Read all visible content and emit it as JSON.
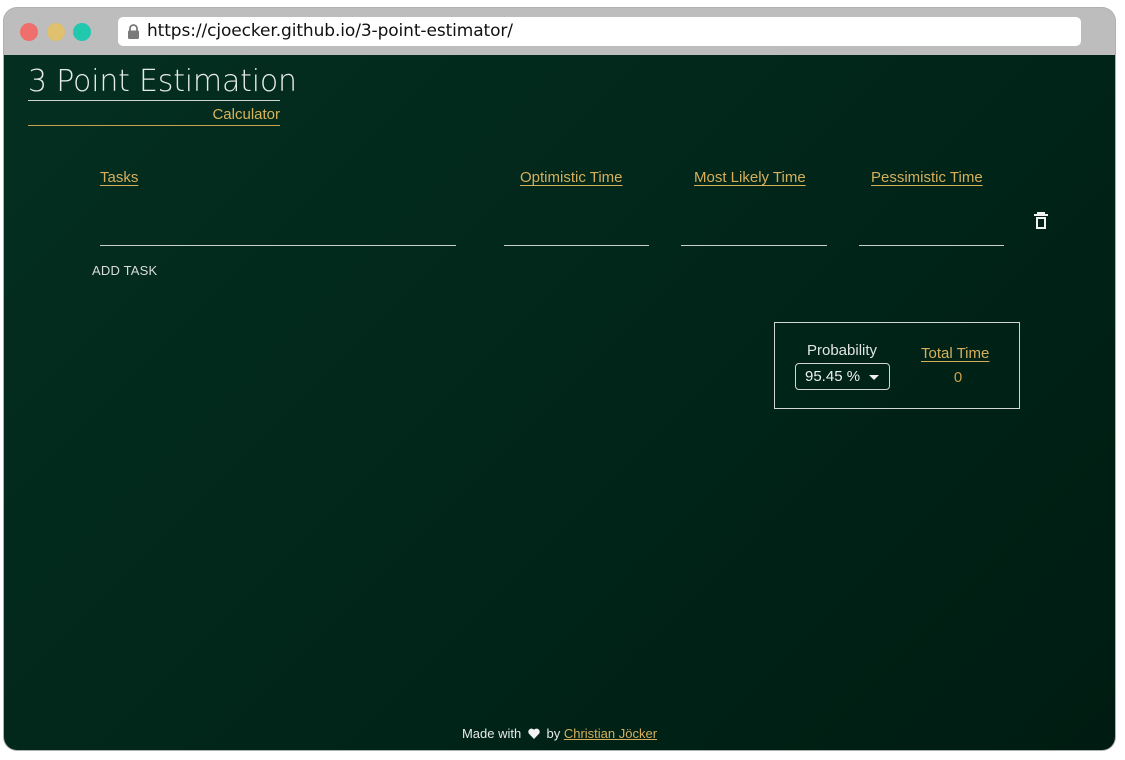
{
  "browser": {
    "url": "https://cjoecker.github.io/3-point-estimator/",
    "lock_icon": "lock-icon"
  },
  "app": {
    "title": "3 Point Estimation",
    "subtitle": "Calculator"
  },
  "table": {
    "columns": [
      "Tasks",
      "Optimistic Time",
      "Most Likely Time",
      "Pessimistic Time"
    ],
    "rows": [
      {
        "task": "",
        "optimistic": "",
        "most_likely": "",
        "pessimistic": ""
      }
    ],
    "delete_icon": "trash-icon",
    "add_label": "ADD TASK"
  },
  "result": {
    "probability_label": "Probability",
    "probability_value": "95.45 %",
    "total_label": "Total Time",
    "total_value": "0"
  },
  "footer": {
    "made_with": "Made with",
    "by": "by",
    "author": "Christian Jöcker"
  },
  "colors": {
    "accent": "#d6af5c",
    "background": "#02291b",
    "text": "#e9e9e9"
  }
}
